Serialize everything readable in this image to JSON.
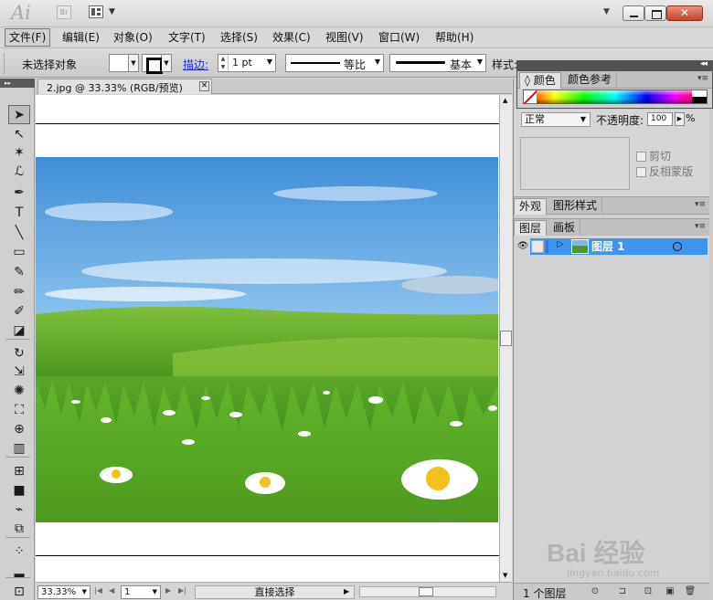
{
  "app": {
    "logo_text": "Ai",
    "bridge_label": "Br"
  },
  "menu": [
    "文件(F)",
    "编辑(E)",
    "对象(O)",
    "文字(T)",
    "选择(S)",
    "效果(C)",
    "视图(V)",
    "窗口(W)",
    "帮助(H)"
  ],
  "control_bar": {
    "selection_status": "未选择对象",
    "stroke_label": "描边:",
    "stroke_weight": "1 pt",
    "profile_label": "等比",
    "brush_label": "基本",
    "style_label": "样式:"
  },
  "toolbar": {
    "collapse_glyph": "▸▸",
    "tools": [
      {
        "name": "selection-tool",
        "glyph": "➤"
      },
      {
        "name": "direct-selection-tool",
        "glyph": "↖"
      },
      {
        "name": "magic-wand-tool",
        "glyph": "✶"
      },
      {
        "name": "lasso-tool",
        "glyph": "ℒ"
      },
      {
        "name": "pen-tool",
        "glyph": "✒"
      },
      {
        "name": "type-tool",
        "glyph": "T"
      },
      {
        "name": "line-tool",
        "glyph": "╲"
      },
      {
        "name": "rectangle-tool",
        "glyph": "▭"
      },
      {
        "name": "paintbrush-tool",
        "glyph": "✎"
      },
      {
        "name": "pencil-tool",
        "glyph": "✏"
      },
      {
        "name": "blob-brush-tool",
        "glyph": "✐"
      },
      {
        "name": "eraser-tool",
        "glyph": "◪"
      },
      {
        "name": "rotate-tool",
        "glyph": "↻"
      },
      {
        "name": "scale-tool",
        "glyph": "⇲"
      },
      {
        "name": "warp-tool",
        "glyph": "✺"
      },
      {
        "name": "free-transform-tool",
        "glyph": "⛶"
      },
      {
        "name": "shape-builder-tool",
        "glyph": "⊕"
      },
      {
        "name": "graph-tool",
        "glyph": "▥"
      },
      {
        "name": "mesh-tool",
        "glyph": "⊞"
      },
      {
        "name": "gradient-tool",
        "glyph": "■"
      },
      {
        "name": "eyedropper-tool",
        "glyph": "⌁"
      },
      {
        "name": "blend-tool",
        "glyph": "⧉"
      },
      {
        "name": "symbol-sprayer-tool",
        "glyph": "⁘"
      },
      {
        "name": "column-graph-tool",
        "glyph": "▂"
      },
      {
        "name": "artboard-tool",
        "glyph": "⊡"
      }
    ]
  },
  "document": {
    "tab_title": "2.jpg @ 33.33% (RGB/预览)",
    "close_glyph": "✕"
  },
  "status_bar": {
    "zoom": "33.33%",
    "page": "1",
    "current_tool": "直接选择"
  },
  "color_panel": {
    "tabs": [
      "颜色",
      "颜色参考"
    ],
    "collapse_glyph": "◂◂",
    "menu_glyph": "▾≡"
  },
  "transparency": {
    "blend_mode": "正常",
    "opacity_label": "不透明度:",
    "opacity_value": "100",
    "opacity_unit": "%",
    "clip_label": "剪切",
    "invert_mask_label": "反相蒙版"
  },
  "appearance_panel": {
    "tabs": [
      "外观",
      "图形样式"
    ]
  },
  "layers_panel": {
    "tabs": [
      "图层",
      "画板"
    ],
    "layer_name": "图层 1",
    "layer_count": "1 个图层"
  },
  "watermark": {
    "brand": "Bai 经验",
    "url": "jingyan.baidu.com"
  },
  "colors": {
    "selection_blue": "#3c95ee",
    "stroke_link_blue": "#1d2fd6",
    "close_button_red": "#c4442d"
  }
}
